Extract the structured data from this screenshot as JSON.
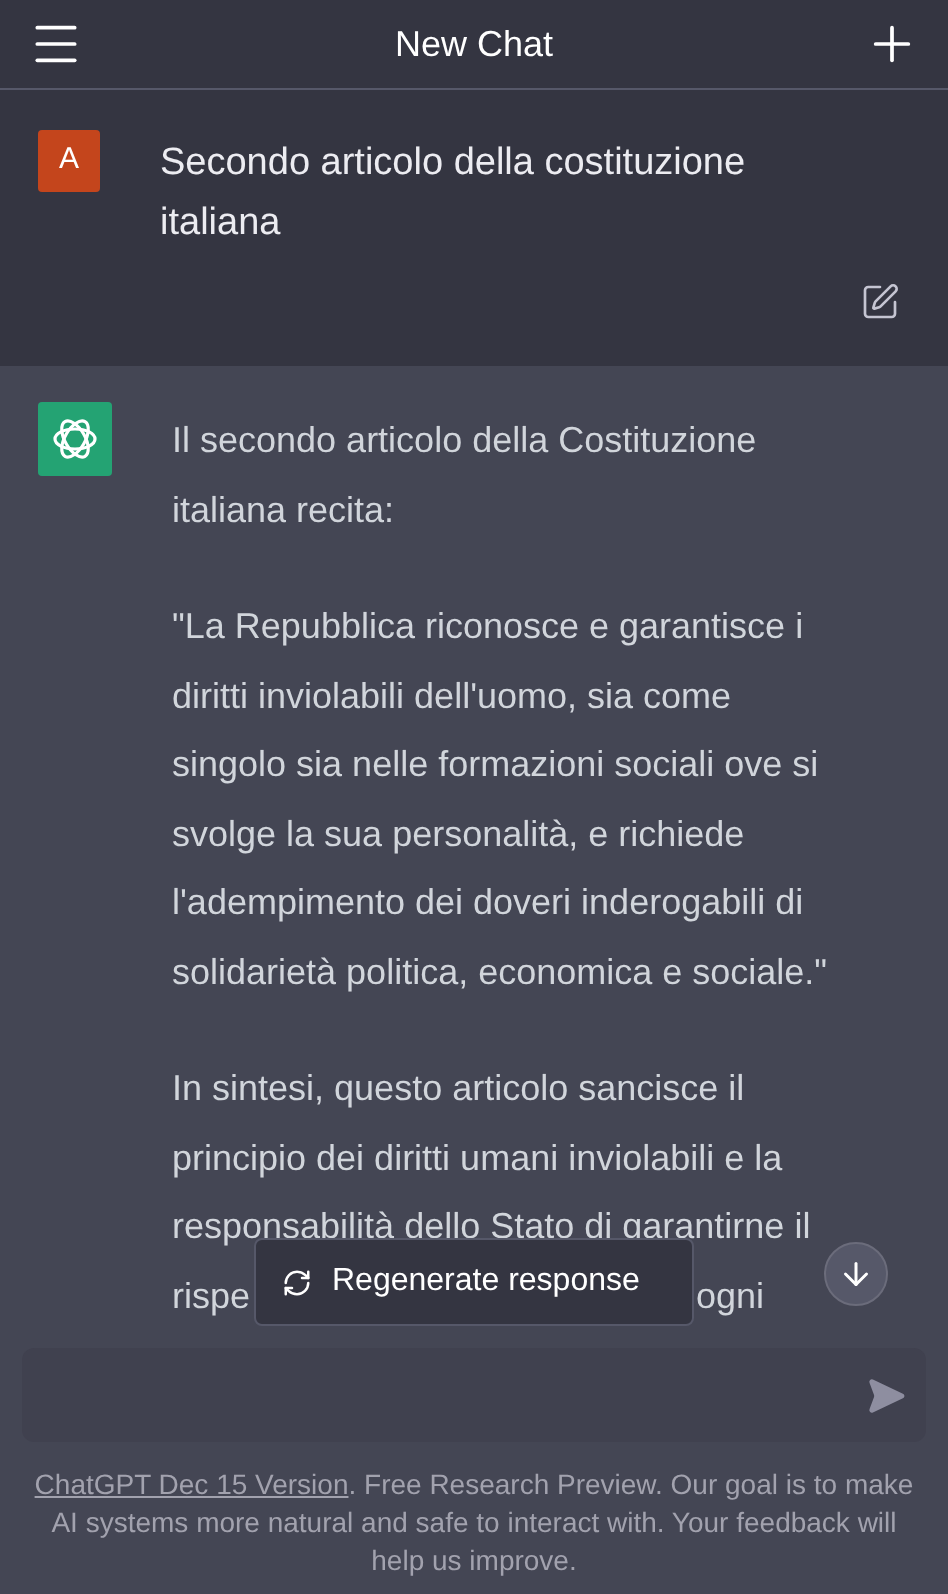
{
  "header": {
    "title": "New Chat"
  },
  "user_message": {
    "avatar": "A",
    "text": "Secondo articolo della costituzione italiana"
  },
  "assistant_message": {
    "paragraphs": [
      {
        "lines": [
          "Il secondo articolo della Costituzione",
          "italiana recita:"
        ]
      },
      {
        "lines": [
          "\"La Repubblica riconosce e garantisce i",
          "diritti inviolabili dell'uomo, sia come",
          "singolo sia nelle formazioni sociali ove si",
          "svolge la sua personalità, e richiede",
          "l'adempimento dei doveri inderogabili di",
          "solidarietà politica, economica e sociale.\""
        ]
      },
      {
        "lines": [
          "In sintesi, questo articolo sancisce il",
          "principio dei diritti umani inviolabili e la",
          "responsabilità dello Stato di garantirne il"
        ],
        "cut_line": {
          "start": "rispe",
          "end": "ogni"
        }
      }
    ]
  },
  "regenerate_button": {
    "label": "Regenerate response"
  },
  "footer": {
    "link": "ChatGPT Dec 15 Version",
    "text": ". Free Research Preview. Our goal is to make AI systems more natural and safe to interact with. Your feedback will help us improve."
  }
}
